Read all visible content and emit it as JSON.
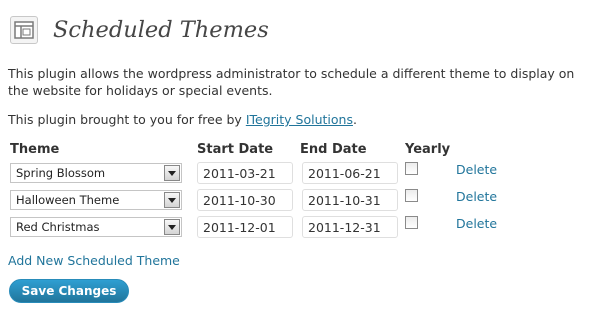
{
  "page": {
    "title": "Scheduled Themes",
    "description": "This plugin allows the wordpress administrator to schedule a different theme to display on the website for holidays or special events.",
    "credit_prefix": "This plugin brought to you for free by ",
    "credit_link": "ITegrity Solutions",
    "credit_suffix": "."
  },
  "table": {
    "headers": {
      "theme": "Theme",
      "start": "Start Date",
      "end": "End Date",
      "yearly": "Yearly"
    },
    "rows": [
      {
        "theme": "Spring Blossom",
        "start": "2011-03-21",
        "end": "2011-06-21",
        "yearly": false,
        "action": "Delete"
      },
      {
        "theme": "Halloween Theme",
        "start": "2011-10-30",
        "end": "2011-10-31",
        "yearly": false,
        "action": "Delete"
      },
      {
        "theme": "Red Christmas",
        "start": "2011-12-01",
        "end": "2011-12-31",
        "yearly": false,
        "action": "Delete"
      }
    ]
  },
  "actions": {
    "add_label": "Add New Scheduled Theme",
    "save_label": "Save Changes"
  },
  "icons": {
    "page": "appearance-layout-icon",
    "select": "chevron-down-icon"
  },
  "colors": {
    "link": "#21759b",
    "button": "#21759b",
    "title": "#464646"
  }
}
